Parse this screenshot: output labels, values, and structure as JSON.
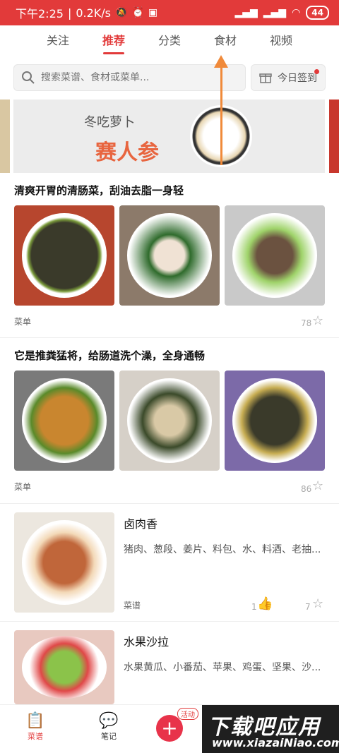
{
  "status": {
    "time": "下午2:25",
    "speed": "0.2K/s",
    "battery": "44"
  },
  "tabs": [
    "关注",
    "推荐",
    "分类",
    "食材",
    "视频"
  ],
  "search": {
    "placeholder": "搜索菜谱、食材或菜单..."
  },
  "signin": {
    "label": "今日签到"
  },
  "banner": {
    "line1": "冬吃萝卜",
    "line2": "赛人参"
  },
  "menus": [
    {
      "title": "清爽开胃的清肠菜，刮油去脂一身轻",
      "type": "菜单",
      "count": "78"
    },
    {
      "title": "它是推粪猛将，给肠道洗个澡，全身通畅",
      "type": "菜单",
      "count": "86"
    }
  ],
  "recipes": [
    {
      "title": "卤肉香",
      "ingredients": "猪肉、葱段、姜片、料包、水、料酒、老抽...",
      "type": "菜谱",
      "likes": "1",
      "favs": "7"
    },
    {
      "title": "水果沙拉",
      "ingredients": "水果黄瓜、小番茄、苹果、鸡蛋、坚果、沙..."
    }
  ],
  "nav": {
    "recipes": "菜谱",
    "notes": "笔记",
    "activity": "活动"
  },
  "watermark": {
    "line1": "下载吧应用",
    "line2": "www.xiazaiNiao.com"
  },
  "colors": {
    "accent": "#e23a3a"
  }
}
